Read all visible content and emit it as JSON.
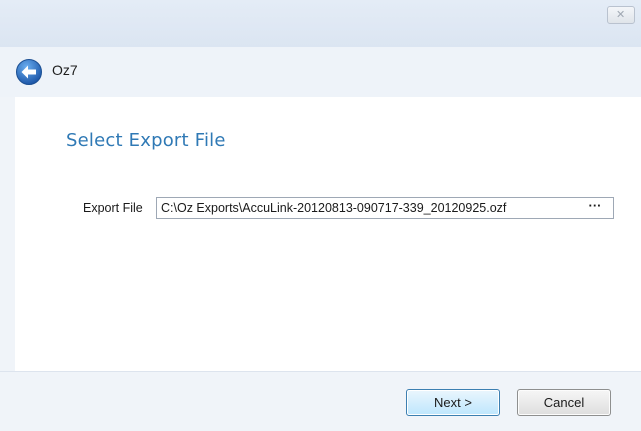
{
  "window": {
    "close_glyph": "✕",
    "app_title": "Oz7"
  },
  "icons": {
    "back": "back-arrow-icon",
    "close": "close-icon"
  },
  "colors": {
    "title_accent": "#2f79b5",
    "back_icon": "#1c66b8",
    "next_button_border": "#3c7fb1"
  },
  "page": {
    "title": "Select Export File"
  },
  "export_field": {
    "label": "Export File",
    "value": "C:\\Oz Exports\\AccuLink-20120813-090717-339_20120925.ozf",
    "browse_label": "···"
  },
  "footer": {
    "next_label": "Next >",
    "cancel_label": "Cancel"
  }
}
